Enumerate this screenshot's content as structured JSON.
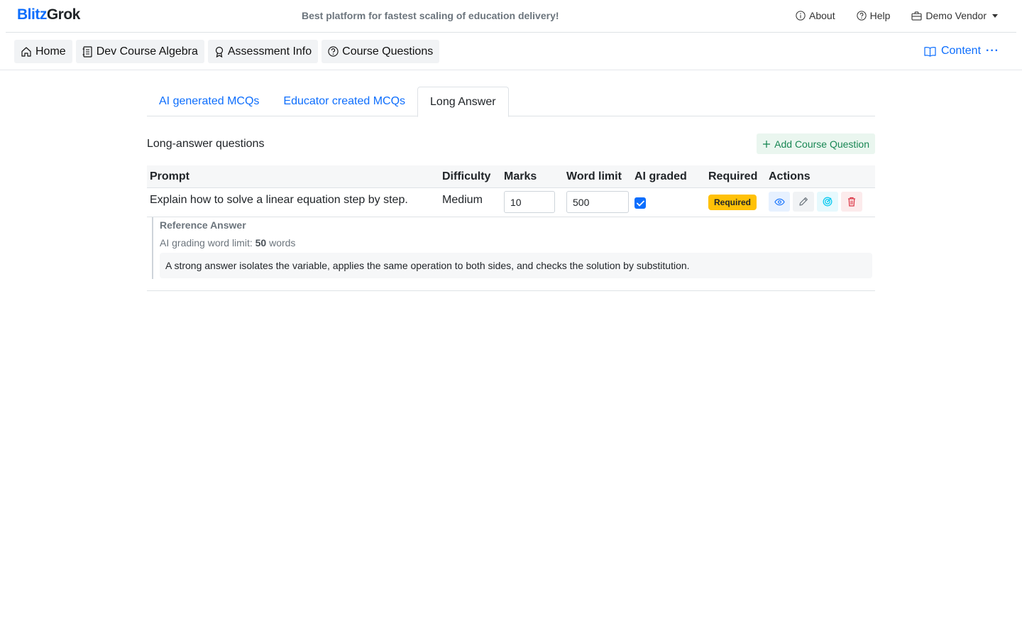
{
  "brand": {
    "part1": "Blitz",
    "part2": "Grok"
  },
  "tagline": "Best platform for fastest scaling of education delivery!",
  "topnav": {
    "about": "About",
    "help": "Help",
    "vendor": "Demo Vendor"
  },
  "breadcrumbs": [
    "Home",
    "Dev Course Algebra",
    "Assessment Info",
    "Course Questions"
  ],
  "content_menu": {
    "label": "Content",
    "more": "···"
  },
  "tabs": [
    "AI generated MCQs",
    "Educator created MCQs",
    "Long Answer"
  ],
  "active_tab": "Long Answer",
  "section": {
    "title": "Long-answer questions",
    "add_button": "Add Course Question"
  },
  "table": {
    "headers": [
      "Prompt",
      "Difficulty",
      "Marks",
      "Word limit",
      "AI graded",
      "Required",
      "Actions"
    ],
    "rows": [
      {
        "prompt": "Explain how to solve a linear equation step by step.",
        "difficulty": "Medium",
        "marks": "10",
        "word_limit": "500",
        "ai_graded": true,
        "required_badge": "Required"
      }
    ]
  },
  "reference": {
    "title": "Reference Answer",
    "limit_prefix": "AI grading word limit:",
    "limit_value": "50",
    "limit_suffix": "words",
    "text": "A strong answer isolates the variable, applies the same operation to both sides, and checks the solution by substitution."
  },
  "colors": {
    "primary": "#0d6efd",
    "success": "#198754",
    "warning": "#ffc107",
    "danger": "#dc3545",
    "info": "#0dcaf0"
  },
  "icons": [
    "info-icon",
    "help-icon",
    "briefcase-icon",
    "home-icon",
    "journal-icon",
    "award-icon",
    "question-circle-icon",
    "book-icon",
    "plus-icon",
    "check-icon",
    "eye-icon",
    "pencil-icon",
    "target-icon",
    "trash-icon"
  ]
}
